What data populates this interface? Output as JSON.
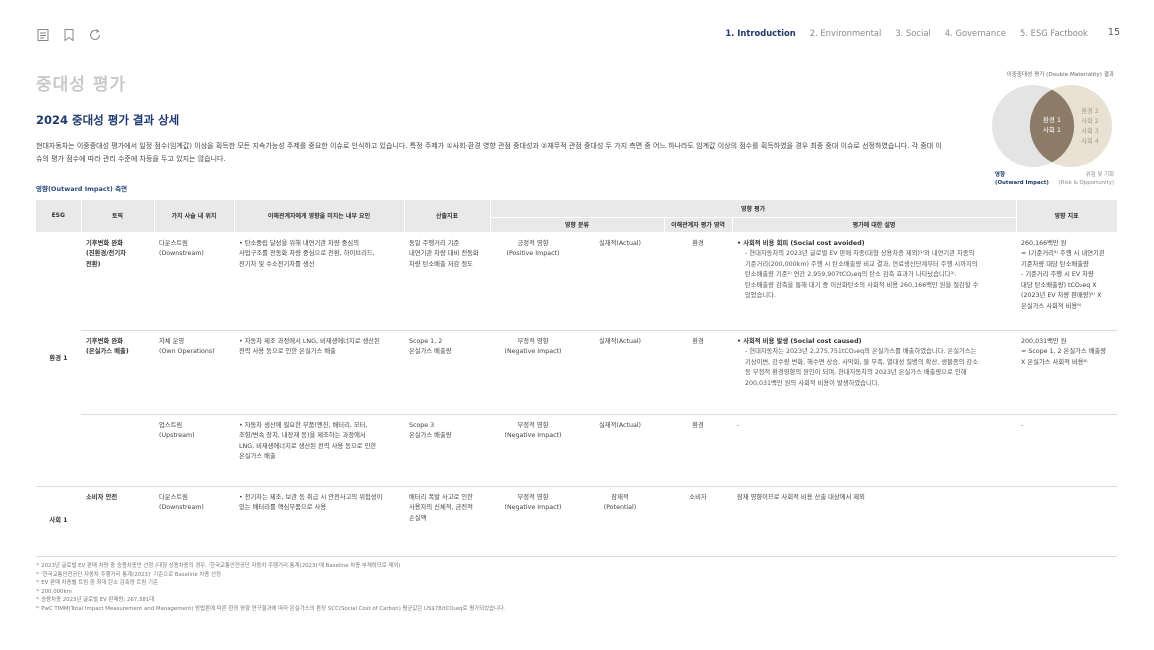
{
  "nav": {
    "tabs": [
      "1. Introduction",
      "2. Environmental",
      "3. Social",
      "4. Governance",
      "5. ESG Factbook"
    ],
    "page_number": "15"
  },
  "page_title": "중대성 평가",
  "section_title": "2024 중대성 평가 결과 상세",
  "intro_text": "현대자동차는 이중중대성 평가에서 일정 점수(임계값) 이상을 획득한 모든 지속가능성 주제를 중요한 이슈로 인식하고 있습니다. 특정 주제가 ①사회·환경 영향 관점 중대성과 ②재무적 관점 중대성 두 가지 측면 중 어느 하나라도 임계값 이상의 점수를 획득하였을 경우 최종 중대 이슈로 선정하였습니다. 각 중대 이슈의 평가 점수에 따라 관리 수준에 차등을 두고 있지는 않습니다.",
  "impact_label": "영향(Outward Impact) 측면",
  "venn": {
    "title": "이중중대성 평가 (Double Materiality) 결과",
    "overlap": [
      "환경 1",
      "사회 1"
    ],
    "right_items": [
      "환경 2",
      "사회 2",
      "사회 3",
      "사회 4"
    ],
    "left_label": [
      "영향",
      "(Outward Impact)"
    ],
    "right_label": [
      "위험 및 기회",
      "(Risk & Opportunity)"
    ]
  },
  "table": {
    "headers": {
      "esg": "ESG",
      "topic": "토픽",
      "value_chain": "가치 사슬 내 위치",
      "factor": "이해관계자에게 영향을 미치는 내부 요인",
      "indicator": "산출지표",
      "impact_eval": "영향 평가",
      "impact_class": "영향 분류",
      "stakeholder_area": "이해관계자 평가 영역",
      "eval_desc": "평가에 대한 설명",
      "impact_index": "영향 지표"
    },
    "groups": [
      {
        "esg": "환경 1",
        "rows": [
          {
            "topic": [
              "기후변화 완화",
              "(친환경/전기차",
              "전환)"
            ],
            "value_chain": [
              "다운스트림",
              "(Downstream)"
            ],
            "factor": [
              "• 탄소중립 달성을 위해 내연기관 차량 중심의",
              "  사업구조를 전동화 차량 중심으로 전환, 하이브리드,",
              "  전기차 및 수소전기차를 생산"
            ],
            "indicator": [
              "동일 주행거리 기준",
              "내연기관 차량 대비 전동화",
              "차량 탄소배출 저감 정도"
            ],
            "impact_type": [
              "긍정적 영향",
              "(Positive Impact)"
            ],
            "actuality": [
              "실재적(Actual)"
            ],
            "area": [
              "환경"
            ],
            "desc_title": "• 사회적 비용 회피 (Social cost avoided)",
            "desc": [
              "- 현대자동차의 2023년 글로벌 EV 판매 차종(대형 상용차종 제외)¹⁾와 내연기관 차종의",
              "  기준거리(200,000km) 주행 시 탄소배출량 비교 결과, 연료생산단계부터 주행 시까지의",
              "  탄소배출량 기준²⁾ 연간 2,959,907tCO₂eq의 탄소 감축 효과가 나타났습니다³⁾.",
              "  탄소배출량 감축을 통해 대기 중 이산화탄소의 사회적 비용 260,166백만 원을 절감할 수",
              "  있었습니다."
            ],
            "index": [
              "260,166백만 원",
              "= (기준거리⁴⁾ 주행 시 내연기관",
              "기준차량 대당 탄소배출량",
              "- 기준거리 주행 시 EV 차량",
              "대당 탄소배출량) tCO₂eq X",
              "(2023년 EV 차량 판매량)⁵⁾ X",
              "온실가스 사회적 비용⁶⁾"
            ]
          },
          {
            "topic": [
              "기후변화 완화",
              "(온실가스 배출)"
            ],
            "value_chain": [
              "자체 운영",
              "(Own Operations)"
            ],
            "factor": [
              "• 자동차 제조 과정에서 LNG, 비재생에너지로 생산된",
              "  전력 사용 등으로 인한 온실가스 배출"
            ],
            "indicator": [
              "Scope 1, 2",
              "온실가스 배출량"
            ],
            "impact_type": [
              "부정적 영향",
              "(Negative Impact)"
            ],
            "actuality": [
              "실재적(Actual)"
            ],
            "area": [
              "환경"
            ],
            "desc_title": "• 사회적 비용 발생 (Social cost caused)",
            "desc": [
              "- 현대자동차는 2023년 2,275,751tCO₂eq의 온실가스를 배출하였습니다. 온실가스는",
              "  기상이변, 강수량 변화, 해수면 상승, 사막화, 물 부족, 열대성 질병의 확산, 생물종의 감소",
              "  등 부정적 환경영향의 원인이 되며, 현대자동차의 2023년 온실가스 배출량으로 인해",
              "  200,031백만 원의 사회적 비용이 발생하였습니다."
            ],
            "index": [
              "200,031백만 원",
              "= Scope 1, 2 온실가스 배출량",
              "X 온실가스 사회적 비용⁶⁾"
            ]
          },
          {
            "topic": [],
            "value_chain": [
              "업스트림",
              "(Upstream)"
            ],
            "factor": [
              "• 자동차 생산에 필요한 부품(엔진, 배터리, 모터,",
              "  조향/변속 장치, 내장재 등)을 제조하는 과정에서",
              "  LNG, 비재생에너지로 생산된 전력 사용 등으로 인한",
              "  온실가스 배출"
            ],
            "indicator": [
              "Scope 3",
              "온실가스 배출량"
            ],
            "impact_type": [
              "부정적 영향",
              "(Negative Impact)"
            ],
            "actuality": [
              "실재적(Actual)"
            ],
            "area": [
              "환경"
            ],
            "desc_title": "",
            "desc": [
              "-"
            ],
            "index": [
              "-"
            ]
          }
        ]
      },
      {
        "esg": "사회 1",
        "rows": [
          {
            "topic": [
              "소비자 안전"
            ],
            "value_chain": [
              "다운스트림",
              "(Downstream)"
            ],
            "factor": [
              "• 전기차는 제조, 보관 등 취급 시 안전사고의 위험성이",
              "  있는 배터리를 핵심부품으로 사용"
            ],
            "indicator": [
              "배터리 폭발 사고로 인한",
              "사용자의 신체적, 금전적",
              "손실액"
            ],
            "impact_type": [
              "부정적 영향",
              "(Negative Impact)"
            ],
            "actuality": [
              "잠재적",
              "(Potential)"
            ],
            "area": [
              "소비자"
            ],
            "desc_title": "",
            "desc": [
              "잠재 영향이므로 사회적 비용 산출 대상에서 제외"
            ],
            "index": []
          }
        ]
      }
    ]
  },
  "footnotes": [
    "¹⁾ 2023년 글로벌 EV 판매 차량 중 승용차종만 선정 (대형 상용차종의 경우, '한국교통안전공단 자동차 주행거리 통계(2023)'에 Baseline 차종 부재하므로 제외)",
    "²⁾ '한국교통안전공단 자동차 주행거리 통계(2023)' 기준으로 Baseline 차종 선정",
    "³⁾ EV 판매 차종별 트림 중 최대 탄소 감축량 트림 기준",
    "⁴⁾ 200,000km",
    "⁵⁾ 승용차종 2023년 글로벌 EV 판매량: 267,381대",
    "⁶⁾ PwC TIMM(Total Impact Measurement and Management) 방법론에 따른 환경 영향 연구결과에 따라 온실가스의 톤당 SCC(Social Cost of Carbon) 평균값은 US$78/tCO₂eq로 평가되었습니다."
  ]
}
